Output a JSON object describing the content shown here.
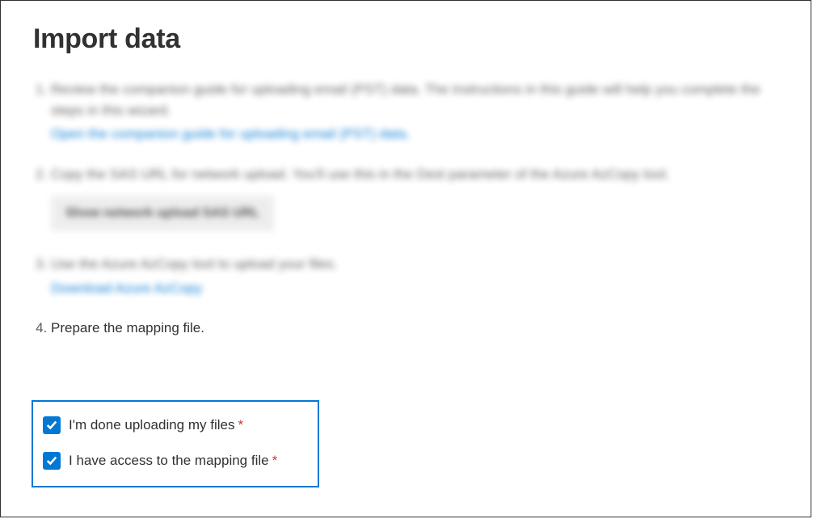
{
  "title": "Import data",
  "steps": {
    "s1": {
      "text": "Review the companion guide for uploading email (PST) data. The instructions in this guide will help you complete the steps in this wizard.",
      "link": "Open the companion guide for uploading email (PST) data."
    },
    "s2": {
      "text": "Copy the SAS URL for network upload. You'll use this in the Dest parameter of the Azure AzCopy tool.",
      "button": "Show network upload SAS URL"
    },
    "s3": {
      "text": "Use the Azure AzCopy tool to upload your files.",
      "link": "Download Azure AzCopy"
    },
    "s4": {
      "text": "Prepare the mapping file."
    }
  },
  "checkboxes": {
    "done_uploading": {
      "label": "I'm done uploading my files",
      "required": "*",
      "checked": true
    },
    "access_mapping": {
      "label": "I have access to the mapping file",
      "required": "*",
      "checked": true
    }
  }
}
